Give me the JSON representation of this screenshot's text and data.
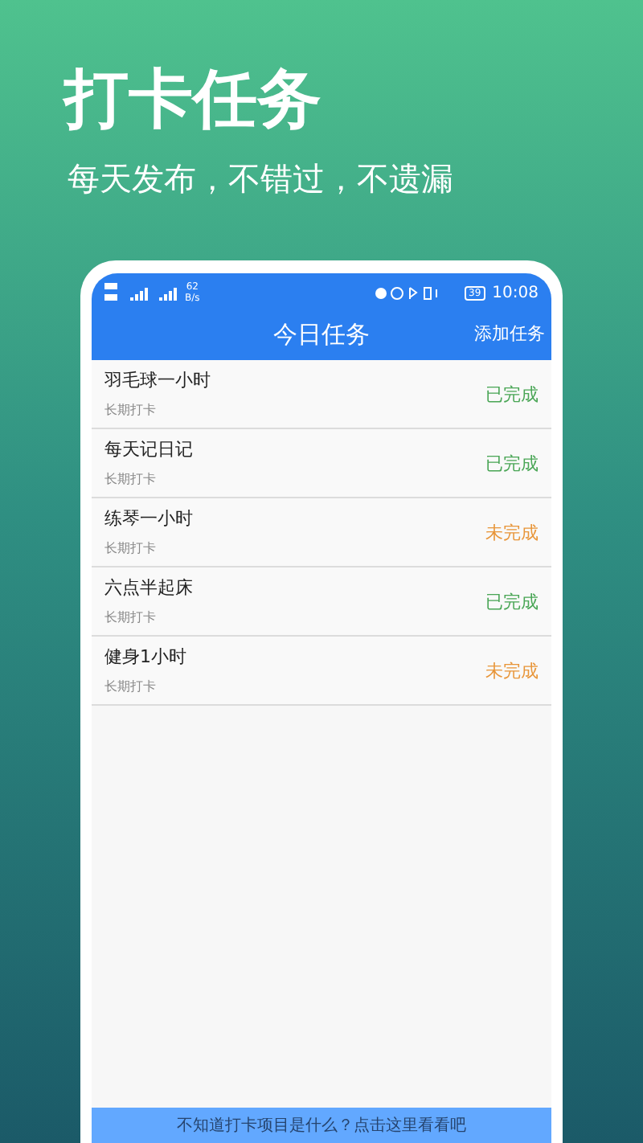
{
  "headline": "打卡任务",
  "tagline": "每天发布，不错过，不遗漏",
  "status_bar": {
    "net_speed": "62",
    "net_unit": "B/s",
    "battery": "39",
    "time": "10:08"
  },
  "app_bar": {
    "title": "今日任务",
    "action": "添加任务"
  },
  "tasks": [
    {
      "name": "羽毛球一小时",
      "type": "长期打卡",
      "status": "已完成",
      "completed": true
    },
    {
      "name": "每天记日记",
      "type": "长期打卡",
      "status": "已完成",
      "completed": true
    },
    {
      "name": "练琴一小时",
      "type": "长期打卡",
      "status": "未完成",
      "completed": false
    },
    {
      "name": "六点半起床",
      "type": "长期打卡",
      "status": "已完成",
      "completed": true
    },
    {
      "name": "健身1小时",
      "type": "长期打卡",
      "status": "未完成",
      "completed": false
    }
  ],
  "help_banner": "不知道打卡项目是什么？点击这里看看吧"
}
